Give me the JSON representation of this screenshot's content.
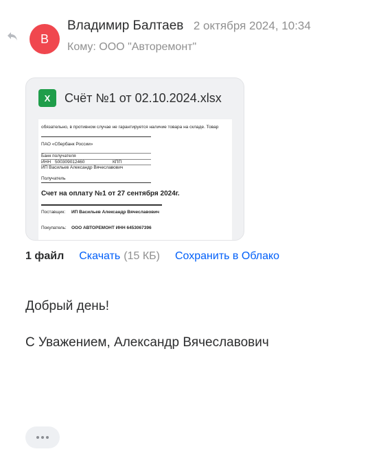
{
  "sender": {
    "avatar_letter": "В",
    "name": "Владимир Балтаев",
    "date": "2 октября 2024, 10:34"
  },
  "recipient": {
    "line": "Кому: ООО \"Авторемонт\""
  },
  "attachment": {
    "icon_letter": "X",
    "file_name": "Счёт №1 от 02.10.2024.xlsx",
    "preview": {
      "notice": "обязательно, в противном случае не гарантируется наличие товара на складе. Товар",
      "bank": "ПАО «Сбербанк России»",
      "bank_label": "Банк получателя",
      "inn_label": "ИНН",
      "inn_value": "500309012460",
      "kpp_label": "КПП",
      "recipient_name": "ИП Васильев Александр Вячеславович",
      "recipient_label": "Получатель",
      "title": "Счет на оплату №1 от 27 сентября 2024г.",
      "supplier_label": "Поставщик:",
      "supplier_value": "ИП Васильев Александр Вячеславович",
      "buyer_label": "Покупатель:",
      "buyer_value": "ООО АВТОРЕМОНТ ИНН  6453067396"
    }
  },
  "actions": {
    "count": "1 файл",
    "download": "Скачать",
    "size": "(15 КБ)",
    "save_cloud": "Сохранить в Облако"
  },
  "message": {
    "greeting": "Добрый день!",
    "signature": "С Уважением, Александр Вячеславович"
  },
  "icons": {
    "reply": "reply-arrow-icon",
    "excel": "excel-file-icon",
    "more": "more-dots-icon"
  },
  "colors": {
    "avatar_bg": "#f0474e",
    "link": "#005ff9",
    "excel": "#1f9d4a"
  }
}
